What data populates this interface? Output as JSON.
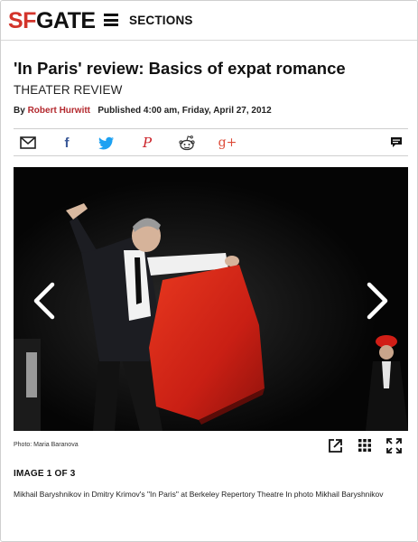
{
  "masthead": {
    "logo_sf": "SF",
    "logo_gate": "GATE",
    "menu_icon": "hamburger-menu-icon",
    "sections_label": "SECTIONS"
  },
  "article": {
    "headline": "'In Paris' review: Basics of expat romance",
    "kicker": "THEATER REVIEW",
    "byline_prefix": "By",
    "author": "Robert Hurwitt",
    "published": "Published 4:00 am, Friday, April 27, 2012"
  },
  "share": {
    "icons": [
      "email-icon",
      "facebook-icon",
      "twitter-icon",
      "pinterest-icon",
      "reddit-icon",
      "googleplus-icon",
      "comment-icon"
    ],
    "facebook_glyph": "f",
    "pinterest_glyph": "P",
    "googleplus_glyph": "g+"
  },
  "gallery": {
    "photo_credit": "Photo: Maria Baranova",
    "counter": "IMAGE 1 OF 3",
    "caption": "Mikhail Baryshnikov in Dmitry Krimov's \"In Paris\" at Berkeley Repertory Theatre In photo Mikhail Baryshnikov",
    "prev_icon": "chevron-left-icon",
    "next_icon": "chevron-right-icon",
    "tool_icons": [
      "external-link-icon",
      "grid-icon",
      "fullscreen-icon"
    ]
  },
  "colors": {
    "brand_red": "#d3342b",
    "author_red": "#b3282d",
    "facebook_blue": "#3b5998",
    "twitter_blue": "#1da1f2",
    "pinterest_red": "#cb2027",
    "googleplus_red": "#dd4b39",
    "cape_red": "#d8261b"
  }
}
